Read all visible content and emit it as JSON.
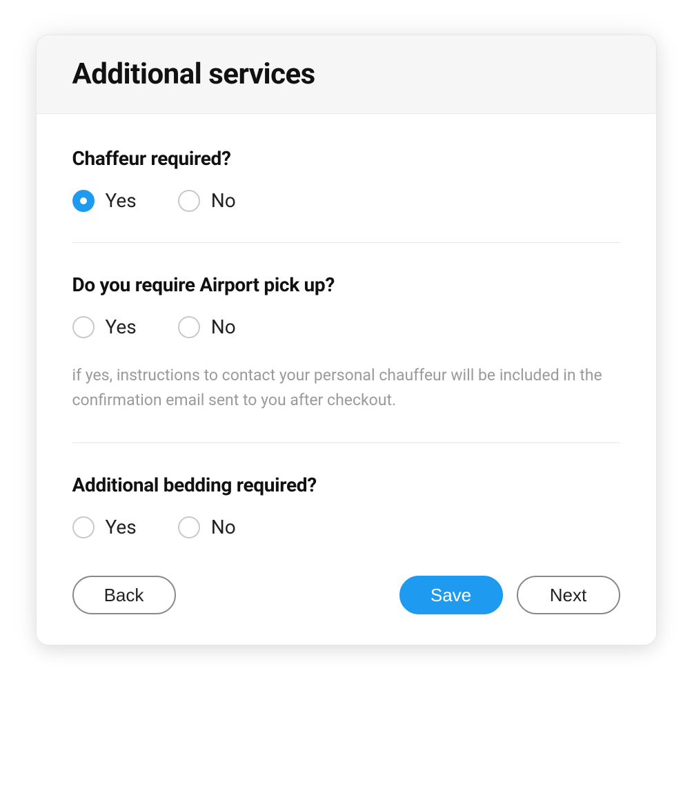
{
  "colors": {
    "accent": "#1e9bf0",
    "border": "#e6e6e6",
    "textMuted": "#9a9a9a"
  },
  "header": {
    "title": "Additional services"
  },
  "questions": [
    {
      "label": "Chaffeur required?",
      "options": {
        "yes": "Yes",
        "no": "No"
      },
      "selected": "yes",
      "helper": null
    },
    {
      "label": "Do you require Airport pick up?",
      "options": {
        "yes": "Yes",
        "no": "No"
      },
      "selected": null,
      "helper": "if yes, instructions to contact your personal chauffeur will be included in the confirmation email sent to you after checkout."
    },
    {
      "label": "Additional bedding required?",
      "options": {
        "yes": "Yes",
        "no": "No"
      },
      "selected": null,
      "helper": null
    }
  ],
  "buttons": {
    "back": "Back",
    "save": "Save",
    "next": "Next"
  }
}
